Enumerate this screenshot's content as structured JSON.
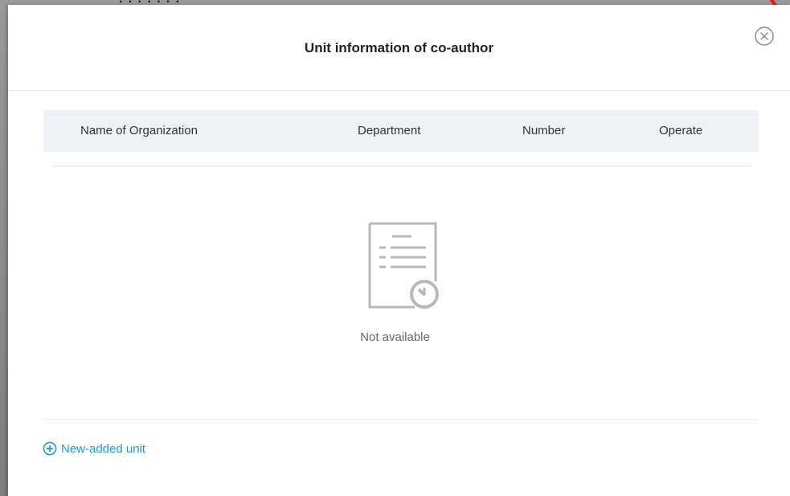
{
  "background": {
    "fragment_text": "· · · · · · ·"
  },
  "dialog": {
    "title": "Unit information of co-author",
    "close_icon": "close-circle-icon"
  },
  "table": {
    "columns": [
      "Name of Organization",
      "Department",
      "Number",
      "Operate"
    ],
    "rows": []
  },
  "empty_state": {
    "icon": "empty-document-icon",
    "text": "Not available"
  },
  "actions": {
    "add_unit_icon": "plus-circle-icon",
    "add_unit_label": "New-added unit"
  },
  "colors": {
    "accent": "#1f9ae0",
    "header_bg": "#eef2f6",
    "alert_mark": "#e01818"
  }
}
